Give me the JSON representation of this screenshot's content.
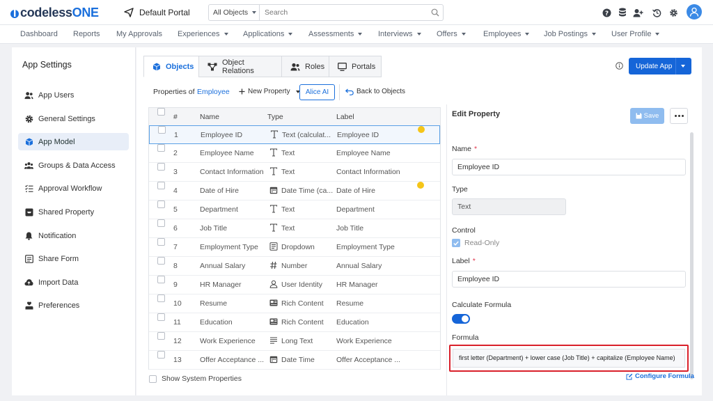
{
  "app": {
    "logo_prefix": "codeless",
    "logo_suffix": "ONE",
    "portal": "Default Portal"
  },
  "search": {
    "object_filter": "All Objects",
    "placeholder": "Search"
  },
  "nav": {
    "items": [
      {
        "label": "Dashboard",
        "dropdown": false
      },
      {
        "label": "Reports",
        "dropdown": false
      },
      {
        "label": "My Approvals",
        "dropdown": false
      },
      {
        "label": "Experiences",
        "dropdown": true
      },
      {
        "label": "Applications",
        "dropdown": true
      },
      {
        "label": "Assessments",
        "dropdown": true
      },
      {
        "label": "Interviews",
        "dropdown": true
      },
      {
        "label": "Offers",
        "dropdown": true
      },
      {
        "label": "Employees",
        "dropdown": true
      },
      {
        "label": "Job Postings",
        "dropdown": true
      },
      {
        "label": "User Profile",
        "dropdown": true
      }
    ]
  },
  "sidebar": {
    "title": "App Settings",
    "items": [
      {
        "label": "App Users",
        "icon": "users-icon"
      },
      {
        "label": "General Settings",
        "icon": "gear-icon"
      },
      {
        "label": "App Model",
        "icon": "cube-icon",
        "active": true
      },
      {
        "label": "Groups & Data Access",
        "icon": "group-icon"
      },
      {
        "label": "Approval Workflow",
        "icon": "list-check-icon"
      },
      {
        "label": "Shared Property",
        "icon": "inbox-icon"
      },
      {
        "label": "Notification",
        "icon": "bell-icon"
      },
      {
        "label": "Share Form",
        "icon": "form-icon"
      },
      {
        "label": "Import Data",
        "icon": "cloud-upload-icon"
      },
      {
        "label": "Preferences",
        "icon": "user-heart-icon"
      }
    ]
  },
  "tabs": [
    {
      "label": "Objects",
      "icon": "cube-icon",
      "active": true
    },
    {
      "label": "Object Relations",
      "icon": "relations-icon"
    },
    {
      "label": "Roles",
      "icon": "roles-icon"
    },
    {
      "label": "Portals",
      "icon": "monitor-icon"
    }
  ],
  "toolbar": {
    "update_app": "Update App",
    "properties_of": "Properties of",
    "object_name": "Employee",
    "new_property": "New Property",
    "alice_ai": "Alice AI",
    "back_to_objects": "Back to Objects"
  },
  "table": {
    "headers": {
      "num": "#",
      "name": "Name",
      "type": "Type",
      "label": "Label"
    },
    "rows": [
      {
        "num": "1",
        "name": "Employee ID",
        "type": "Text (calculat...",
        "type_icon": "text-icon",
        "label": "Employee ID",
        "dot": true,
        "selected": true
      },
      {
        "num": "2",
        "name": "Employee Name",
        "type": "Text",
        "type_icon": "text-icon",
        "label": "Employee Name"
      },
      {
        "num": "3",
        "name": "Contact Information",
        "type": "Text",
        "type_icon": "text-icon",
        "label": "Contact Information"
      },
      {
        "num": "4",
        "name": "Date of Hire",
        "type": "Date Time (ca...",
        "type_icon": "calendar-icon",
        "label": "Date of Hire",
        "dot": true
      },
      {
        "num": "5",
        "name": "Department",
        "type": "Text",
        "type_icon": "text-icon",
        "label": "Department"
      },
      {
        "num": "6",
        "name": "Job Title",
        "type": "Text",
        "type_icon": "text-icon",
        "label": "Job Title"
      },
      {
        "num": "7",
        "name": "Employment Type",
        "type": "Dropdown",
        "type_icon": "dropdown-icon",
        "label": "Employment Type"
      },
      {
        "num": "8",
        "name": "Annual Salary",
        "type": "Number",
        "type_icon": "hash-icon",
        "label": "Annual Salary"
      },
      {
        "num": "9",
        "name": "HR Manager",
        "type": "User Identity",
        "type_icon": "user-icon",
        "label": "HR Manager"
      },
      {
        "num": "10",
        "name": "Resume",
        "type": "Rich Content",
        "type_icon": "rich-content-icon",
        "label": "Resume"
      },
      {
        "num": "11",
        "name": "Education",
        "type": "Rich Content",
        "type_icon": "rich-content-icon",
        "label": "Education"
      },
      {
        "num": "12",
        "name": "Work Experience",
        "type": "Long Text",
        "type_icon": "long-text-icon",
        "label": "Work Experience"
      },
      {
        "num": "13",
        "name": "Offer Acceptance ...",
        "type": "Date Time",
        "type_icon": "calendar-icon",
        "label": "Offer Acceptance ..."
      }
    ],
    "show_system": "Show System Properties"
  },
  "edit": {
    "title": "Edit Property",
    "save": "Save",
    "name_label": "Name",
    "name_value": "Employee ID",
    "type_label": "Type",
    "type_value": "Text",
    "control_label": "Control",
    "readonly_label": "Read-Only",
    "label_label": "Label",
    "label_value": "Employee ID",
    "calc_label": "Calculate Formula",
    "formula_label": "Formula",
    "formula_value": "first letter (Department) + lower case (Job Title) + capitalize (Employee Name)",
    "configure": "Configure Formula"
  },
  "colors": {
    "accent": "#1565d8",
    "highlight": "#d9202a",
    "dot": "#f5c518"
  }
}
